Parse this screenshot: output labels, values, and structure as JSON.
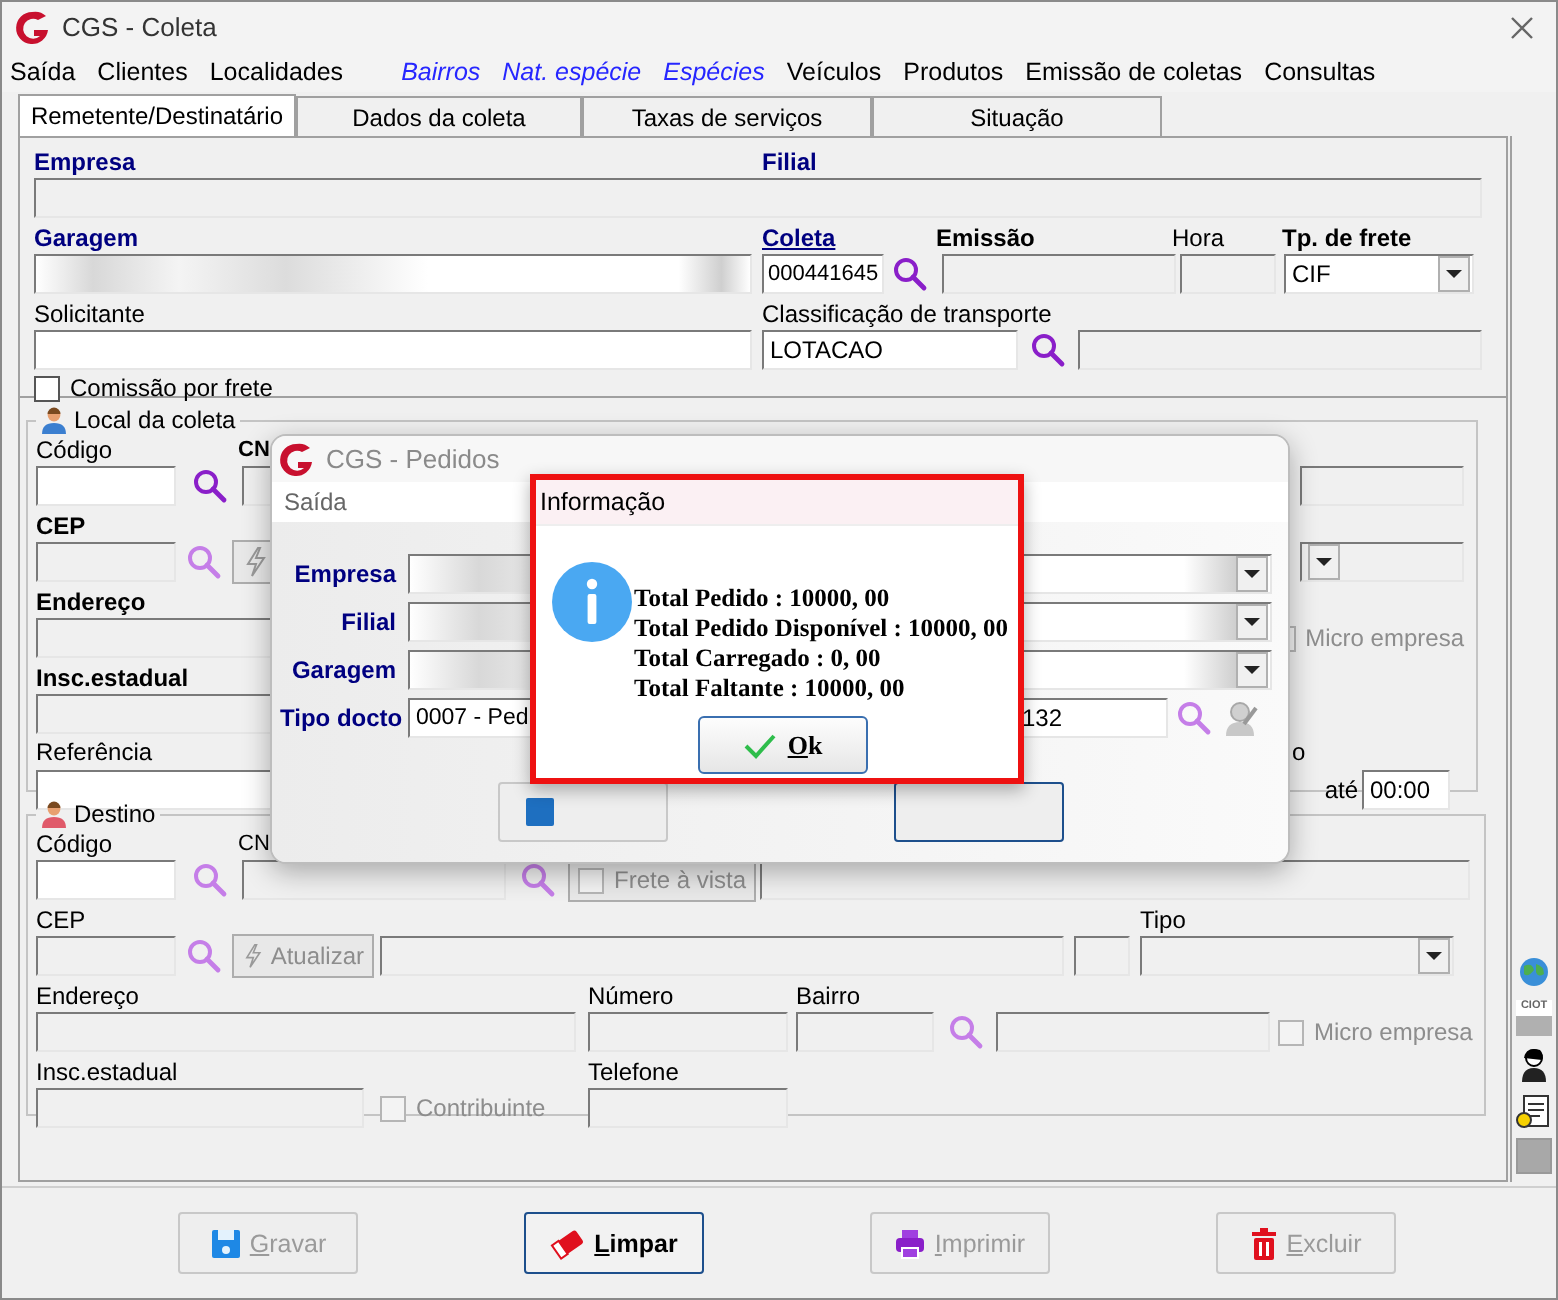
{
  "window": {
    "title": "CGS - Coleta"
  },
  "menu": [
    {
      "label": "Saída",
      "kind": "plain"
    },
    {
      "label": "Clientes",
      "kind": "plain"
    },
    {
      "label": "Localidades",
      "kind": "plain"
    },
    {
      "label": "Bairros",
      "kind": "shortcut"
    },
    {
      "label": "Nat. espécie",
      "kind": "shortcut"
    },
    {
      "label": "Espécies",
      "kind": "shortcut"
    },
    {
      "label": "Veículos",
      "kind": "plain"
    },
    {
      "label": "Produtos",
      "kind": "plain"
    },
    {
      "label": "Emissão de coletas",
      "kind": "plain"
    },
    {
      "label": "Consultas",
      "kind": "plain"
    }
  ],
  "tabs": [
    {
      "label": "Remetente/Destinatário",
      "selected": true
    },
    {
      "label": "Dados da coleta",
      "selected": false
    },
    {
      "label": "Taxas de serviços",
      "selected": false
    },
    {
      "label": "Situação",
      "selected": false
    }
  ],
  "header": {
    "empresa": "Empresa",
    "filial": "Filial",
    "garagem": "Garagem",
    "coleta": "Coleta",
    "coleta_value": "000441645",
    "emissao": "Emissão",
    "hora": "Hora",
    "tipo_frete": "Tp. de frete",
    "tipo_frete_value": "CIF",
    "solicitante": "Solicitante",
    "classificacao": "Classificação de transporte",
    "classificacao_value": "LOTACAO",
    "comissao": {
      "label": "Comissão por frete",
      "checked": false,
      "disabled": false
    }
  },
  "local_coleta": {
    "title": "Local da coleta",
    "codigo": "Código",
    "cnpj": "CN",
    "cep": "CEP",
    "endereco": "Endereço",
    "insc_estadual": "Insc.estadual",
    "referencia": "Referência",
    "micro_empresa": {
      "label": "Micro empresa",
      "checked": false,
      "disabled": true
    },
    "label_7": "o",
    "ate": "até",
    "ate_value": "00:00"
  },
  "destino": {
    "title": "Destino",
    "codigo": "Código",
    "cnpj": "CN",
    "frete_a_vista": {
      "label": "Frete à vista",
      "checked": false,
      "disabled": true
    },
    "cep": "CEP",
    "atualizar": {
      "label": "Atualizar",
      "disabled": true
    },
    "tipo": "Tipo",
    "endereco": "Endereço",
    "numero": "Número",
    "bairro": "Bairro",
    "micro_empresa": {
      "label": "Micro empresa",
      "checked": false,
      "disabled": true
    },
    "insc_estadual": "Insc.estadual",
    "contribuinte": {
      "label": "Contribuinte",
      "checked": false,
      "disabled": true
    },
    "telefone": "Telefone"
  },
  "side_toolbar": {
    "ciot": "CIOT"
  },
  "buttons": [
    {
      "label": "Gravar",
      "kind": "save",
      "disabled": true
    },
    {
      "label": "Limpar",
      "kind": "clear",
      "disabled": false
    },
    {
      "label": "Imprimir",
      "kind": "print",
      "disabled": true
    },
    {
      "label": "Excluir",
      "kind": "delete",
      "disabled": true
    }
  ],
  "pedidos_dialog": {
    "title": "CGS - Pedidos",
    "menu": [
      "Saída"
    ],
    "fields": [
      {
        "label": "Empresa",
        "kind": "select"
      },
      {
        "label": "Filial",
        "kind": "select"
      },
      {
        "label": "Garagem",
        "kind": "select"
      },
      {
        "label": "Tipo docto",
        "kind": "lookup",
        "value": "0007 - Ped",
        "value_2": "132"
      }
    ]
  },
  "info_dialog": {
    "title": "Informação",
    "lines": [
      "Total Pedido : 10000, 00",
      "Total Pedido Disponível : 10000, 00",
      "Total Carregado : 0, 00",
      "Total Faltante : 10000, 00"
    ],
    "button": "Ok"
  }
}
